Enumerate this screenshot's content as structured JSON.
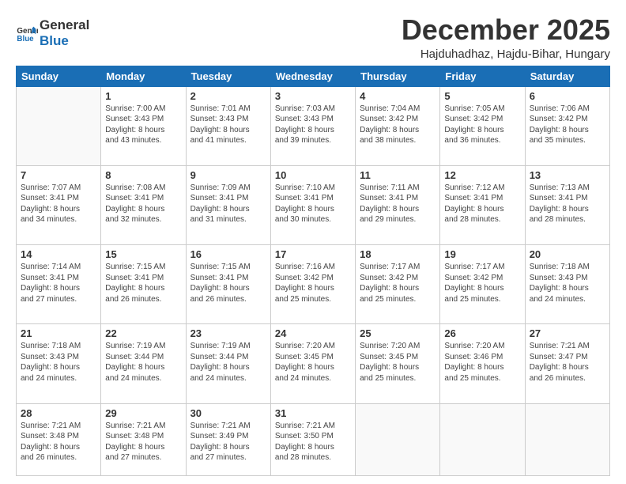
{
  "header": {
    "logo_line1": "General",
    "logo_line2": "Blue",
    "month": "December 2025",
    "location": "Hajduhadhaz, Hajdu-Bihar, Hungary"
  },
  "weekdays": [
    "Sunday",
    "Monday",
    "Tuesday",
    "Wednesday",
    "Thursday",
    "Friday",
    "Saturday"
  ],
  "weeks": [
    [
      {
        "day": "",
        "text": ""
      },
      {
        "day": "1",
        "text": "Sunrise: 7:00 AM\nSunset: 3:43 PM\nDaylight: 8 hours\nand 43 minutes."
      },
      {
        "day": "2",
        "text": "Sunrise: 7:01 AM\nSunset: 3:43 PM\nDaylight: 8 hours\nand 41 minutes."
      },
      {
        "day": "3",
        "text": "Sunrise: 7:03 AM\nSunset: 3:43 PM\nDaylight: 8 hours\nand 39 minutes."
      },
      {
        "day": "4",
        "text": "Sunrise: 7:04 AM\nSunset: 3:42 PM\nDaylight: 8 hours\nand 38 minutes."
      },
      {
        "day": "5",
        "text": "Sunrise: 7:05 AM\nSunset: 3:42 PM\nDaylight: 8 hours\nand 36 minutes."
      },
      {
        "day": "6",
        "text": "Sunrise: 7:06 AM\nSunset: 3:42 PM\nDaylight: 8 hours\nand 35 minutes."
      }
    ],
    [
      {
        "day": "7",
        "text": "Sunrise: 7:07 AM\nSunset: 3:41 PM\nDaylight: 8 hours\nand 34 minutes."
      },
      {
        "day": "8",
        "text": "Sunrise: 7:08 AM\nSunset: 3:41 PM\nDaylight: 8 hours\nand 32 minutes."
      },
      {
        "day": "9",
        "text": "Sunrise: 7:09 AM\nSunset: 3:41 PM\nDaylight: 8 hours\nand 31 minutes."
      },
      {
        "day": "10",
        "text": "Sunrise: 7:10 AM\nSunset: 3:41 PM\nDaylight: 8 hours\nand 30 minutes."
      },
      {
        "day": "11",
        "text": "Sunrise: 7:11 AM\nSunset: 3:41 PM\nDaylight: 8 hours\nand 29 minutes."
      },
      {
        "day": "12",
        "text": "Sunrise: 7:12 AM\nSunset: 3:41 PM\nDaylight: 8 hours\nand 28 minutes."
      },
      {
        "day": "13",
        "text": "Sunrise: 7:13 AM\nSunset: 3:41 PM\nDaylight: 8 hours\nand 28 minutes."
      }
    ],
    [
      {
        "day": "14",
        "text": "Sunrise: 7:14 AM\nSunset: 3:41 PM\nDaylight: 8 hours\nand 27 minutes."
      },
      {
        "day": "15",
        "text": "Sunrise: 7:15 AM\nSunset: 3:41 PM\nDaylight: 8 hours\nand 26 minutes."
      },
      {
        "day": "16",
        "text": "Sunrise: 7:15 AM\nSunset: 3:41 PM\nDaylight: 8 hours\nand 26 minutes."
      },
      {
        "day": "17",
        "text": "Sunrise: 7:16 AM\nSunset: 3:42 PM\nDaylight: 8 hours\nand 25 minutes."
      },
      {
        "day": "18",
        "text": "Sunrise: 7:17 AM\nSunset: 3:42 PM\nDaylight: 8 hours\nand 25 minutes."
      },
      {
        "day": "19",
        "text": "Sunrise: 7:17 AM\nSunset: 3:42 PM\nDaylight: 8 hours\nand 25 minutes."
      },
      {
        "day": "20",
        "text": "Sunrise: 7:18 AM\nSunset: 3:43 PM\nDaylight: 8 hours\nand 24 minutes."
      }
    ],
    [
      {
        "day": "21",
        "text": "Sunrise: 7:18 AM\nSunset: 3:43 PM\nDaylight: 8 hours\nand 24 minutes."
      },
      {
        "day": "22",
        "text": "Sunrise: 7:19 AM\nSunset: 3:44 PM\nDaylight: 8 hours\nand 24 minutes."
      },
      {
        "day": "23",
        "text": "Sunrise: 7:19 AM\nSunset: 3:44 PM\nDaylight: 8 hours\nand 24 minutes."
      },
      {
        "day": "24",
        "text": "Sunrise: 7:20 AM\nSunset: 3:45 PM\nDaylight: 8 hours\nand 24 minutes."
      },
      {
        "day": "25",
        "text": "Sunrise: 7:20 AM\nSunset: 3:45 PM\nDaylight: 8 hours\nand 25 minutes."
      },
      {
        "day": "26",
        "text": "Sunrise: 7:20 AM\nSunset: 3:46 PM\nDaylight: 8 hours\nand 25 minutes."
      },
      {
        "day": "27",
        "text": "Sunrise: 7:21 AM\nSunset: 3:47 PM\nDaylight: 8 hours\nand 26 minutes."
      }
    ],
    [
      {
        "day": "28",
        "text": "Sunrise: 7:21 AM\nSunset: 3:48 PM\nDaylight: 8 hours\nand 26 minutes."
      },
      {
        "day": "29",
        "text": "Sunrise: 7:21 AM\nSunset: 3:48 PM\nDaylight: 8 hours\nand 27 minutes."
      },
      {
        "day": "30",
        "text": "Sunrise: 7:21 AM\nSunset: 3:49 PM\nDaylight: 8 hours\nand 27 minutes."
      },
      {
        "day": "31",
        "text": "Sunrise: 7:21 AM\nSunset: 3:50 PM\nDaylight: 8 hours\nand 28 minutes."
      },
      {
        "day": "",
        "text": ""
      },
      {
        "day": "",
        "text": ""
      },
      {
        "day": "",
        "text": ""
      }
    ]
  ]
}
